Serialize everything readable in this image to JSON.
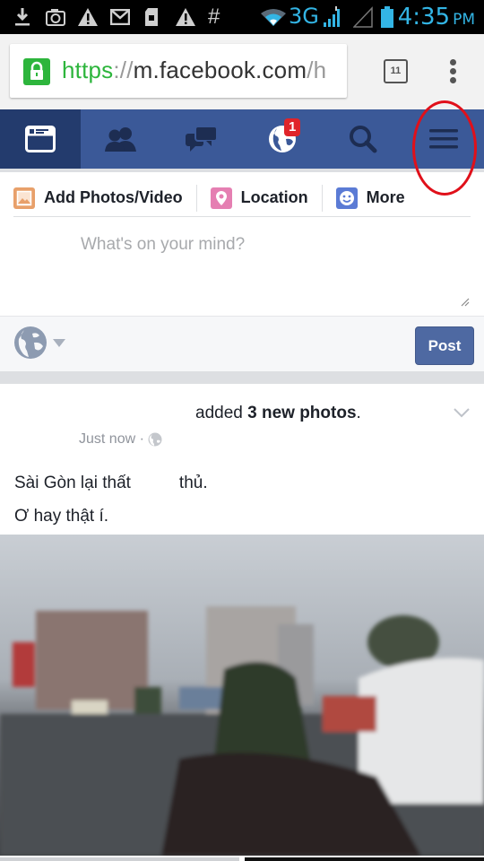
{
  "status_bar": {
    "left_icons": [
      "download-icon",
      "camera-icon",
      "warning-icon",
      "gmail-icon",
      "sd-card-icon",
      "warning-icon",
      "hash-icon"
    ],
    "network": "3G",
    "time": "4:35",
    "ampm": "PM",
    "accent_color": "#33b5e5"
  },
  "browser": {
    "url_scheme": "https",
    "url_separator": "://",
    "url_host": "m.facebook.com",
    "url_path": "/h",
    "tab_count": "11",
    "secure_color": "#2db53c"
  },
  "fb_nav": {
    "brand_color": "#3b5998",
    "items": [
      {
        "name": "news-feed",
        "icon": "news-feed-icon",
        "active": true
      },
      {
        "name": "friend-requests",
        "icon": "friends-icon",
        "active": false
      },
      {
        "name": "messages",
        "icon": "messages-icon",
        "active": false
      },
      {
        "name": "notifications",
        "icon": "globe-icon",
        "active": false,
        "badge": "1"
      },
      {
        "name": "search",
        "icon": "search-icon",
        "active": false
      },
      {
        "name": "menu",
        "icon": "hamburger-menu-icon",
        "active": false
      }
    ]
  },
  "composer": {
    "actions": [
      {
        "label": "Add Photos/Video",
        "icon": "photo-icon",
        "color": "#e8a06a"
      },
      {
        "label": "Location",
        "icon": "location-pin-icon",
        "color": "#e57fb2"
      },
      {
        "label": "More",
        "icon": "smiley-icon",
        "color": "#5b7bd5"
      }
    ],
    "placeholder": "What's on your mind?",
    "value": "",
    "post_label": "Post",
    "privacy": "public"
  },
  "story": {
    "header_prefix": "added ",
    "header_bold": "3 new photos",
    "header_suffix": ".",
    "timestamp": "Just now",
    "meta_separator": " · ",
    "text_line1_a": "Sài Gòn lại thất",
    "text_line1_b": "thủ.",
    "text_line2": "Ơ hay thật í.",
    "photo_description": "Rainy street scene through a wet windshield with a motorbike rider and white car"
  }
}
